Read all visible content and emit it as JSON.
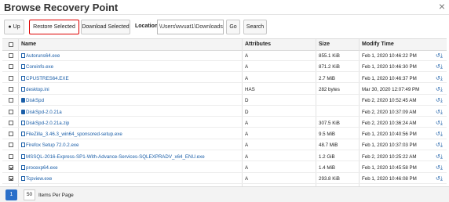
{
  "window": {
    "title": "Browse Recovery Point",
    "close_glyph": "×"
  },
  "toolbar": {
    "up_label": "Up",
    "restore_label": "Restore Selected",
    "download_label": "Download Selected",
    "location_label": "Location",
    "location_value": "\\Users\\wvuat1\\Downloads",
    "go_label": "Go",
    "search_label": "Search"
  },
  "table": {
    "headers": {
      "name": "Name",
      "attributes": "Attributes",
      "size": "Size",
      "modify_time": "Modify Time"
    },
    "rows": [
      {
        "type": "file",
        "name": "Autoruns64.exe",
        "attributes": "A",
        "size": "855.1 KiB",
        "modify_time": "Feb 1, 2020 10:46:22 PM",
        "checked": false
      },
      {
        "type": "file",
        "name": "Coreinfo.exe",
        "attributes": "A",
        "size": "871.2 KiB",
        "modify_time": "Feb 1, 2020 10:46:30 PM",
        "checked": false
      },
      {
        "type": "file",
        "name": "CPUSTRES64.EXE",
        "attributes": "A",
        "size": "2.7 MiB",
        "modify_time": "Feb 1, 2020 10:46:37 PM",
        "checked": false
      },
      {
        "type": "file",
        "name": "desktop.ini",
        "attributes": "HAS",
        "size": "282 bytes",
        "modify_time": "Mar 30, 2020 12:07:49 PM",
        "checked": false
      },
      {
        "type": "folder",
        "name": "DiskSpd",
        "attributes": "D",
        "size": "",
        "modify_time": "Feb 2, 2020 10:52:45 AM",
        "checked": false
      },
      {
        "type": "folder",
        "name": "DiskSpd-2.0.21a",
        "attributes": "D",
        "size": "",
        "modify_time": "Feb 2, 2020 10:37:09 AM",
        "checked": false
      },
      {
        "type": "file",
        "name": "DiskSpd-2.0.21a.zip",
        "attributes": "A",
        "size": "307.5 KiB",
        "modify_time": "Feb 2, 2020 10:36:24 AM",
        "checked": false
      },
      {
        "type": "file",
        "name": "FileZilla_3.46.3_win64_sponsored-setup.exe",
        "attributes": "A",
        "size": "9.5 MiB",
        "modify_time": "Feb 1, 2020 10:40:56 PM",
        "checked": false
      },
      {
        "type": "file",
        "name": "Firefox Setup 72.0.2.exe",
        "attributes": "A",
        "size": "48.7 MiB",
        "modify_time": "Feb 1, 2020 10:37:03 PM",
        "checked": false
      },
      {
        "type": "file",
        "name": "MSSQL-2016-Express-SP1-With-Advance-Services-SQLEXPRADV_x64_ENU.exe",
        "attributes": "A",
        "size": "1.2 GiB",
        "modify_time": "Feb 2, 2020 10:25:22 AM",
        "checked": false
      },
      {
        "type": "file",
        "name": "procexp64.exe",
        "attributes": "A",
        "size": "1.4 MiB",
        "modify_time": "Feb 1, 2020 10:45:58 PM",
        "checked": true
      },
      {
        "type": "file",
        "name": "Tcpview.exe",
        "attributes": "A",
        "size": "293.8 KiB",
        "modify_time": "Feb 1, 2020 10:46:08 PM",
        "checked": true
      }
    ],
    "row_action_icons": [
      "restore-icon",
      "download-icon"
    ]
  },
  "pagination": {
    "current_page": "1",
    "per_page": "50",
    "per_page_label": "Items Per Page"
  },
  "colors": {
    "link": "#1a5ea8",
    "highlight_border": "#dd0000",
    "page_active": "#2a6fc9"
  }
}
